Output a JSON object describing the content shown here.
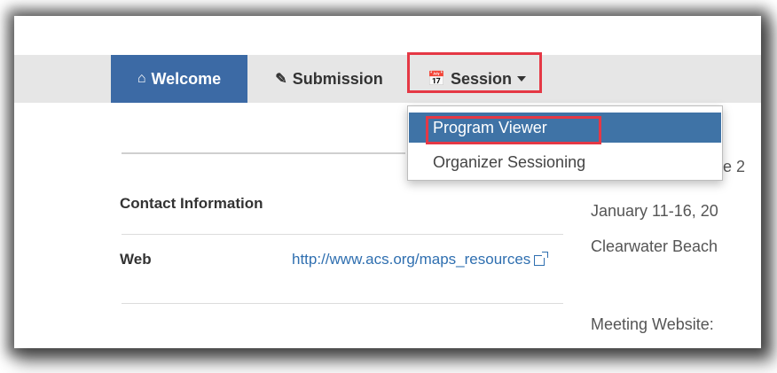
{
  "nav": {
    "welcome": {
      "icon": "home-icon",
      "label": "Welcome"
    },
    "submission": {
      "icon": "pencil-icon",
      "label": "Submission"
    },
    "session": {
      "icon": "calendar-icon",
      "label": "Session"
    }
  },
  "dropdown": {
    "items": [
      {
        "label": "Program Viewer",
        "state": "highlighted"
      },
      {
        "label": "Organizer Sessioning"
      }
    ]
  },
  "contact": {
    "heading": "Contact Information",
    "web_label": "Web",
    "web_link": "http://www.acs.org/maps_resources"
  },
  "right_panel": {
    "fragment": "e 2",
    "dates": "January 11-16, 20",
    "location": "Clearwater Beach",
    "website_label": "Meeting Website:"
  },
  "colors": {
    "nav_active_bg": "#3c6aa5",
    "menu_active_bg": "#3f73a6",
    "annotation_red": "#e53845",
    "link": "#2f6fb0"
  }
}
